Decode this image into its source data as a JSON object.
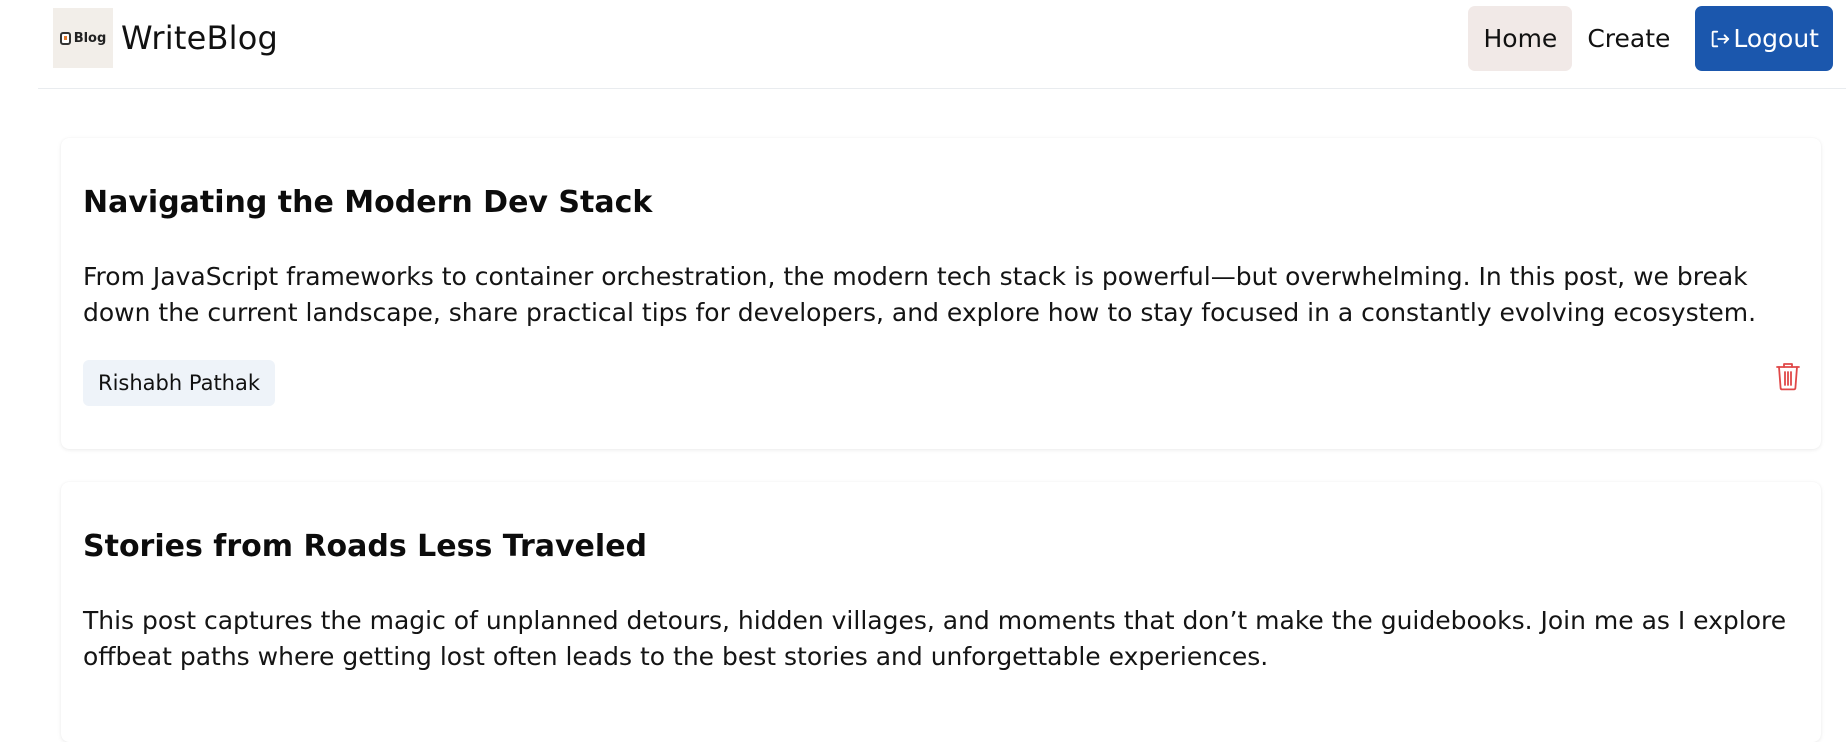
{
  "navbar": {
    "logo_text": "Blog",
    "brand": "WriteBlog",
    "links": [
      {
        "label": "Home",
        "active": true
      },
      {
        "label": "Create",
        "active": false
      }
    ],
    "logout_label": "Logout",
    "accent_color": "#1b57ad"
  },
  "posts": [
    {
      "title": "Navigating the Modern Dev Stack",
      "body": "From JavaScript frameworks to container orchestration, the modern tech stack is powerful—but overwhelming. In this post, we break down the current landscape, share practical tips for developers, and explore how to stay focused in a constantly evolving ecosystem.",
      "author": "Rishabh Pathak",
      "delete_icon": "trash-icon",
      "delete_color": "#e04848"
    },
    {
      "title": "Stories from Roads Less Traveled",
      "body": "This post captures the magic of unplanned detours, hidden villages, and moments that don’t make the guidebooks. Join me as I explore offbeat paths where getting lost often leads to the best stories and unforgettable experiences."
    }
  ]
}
